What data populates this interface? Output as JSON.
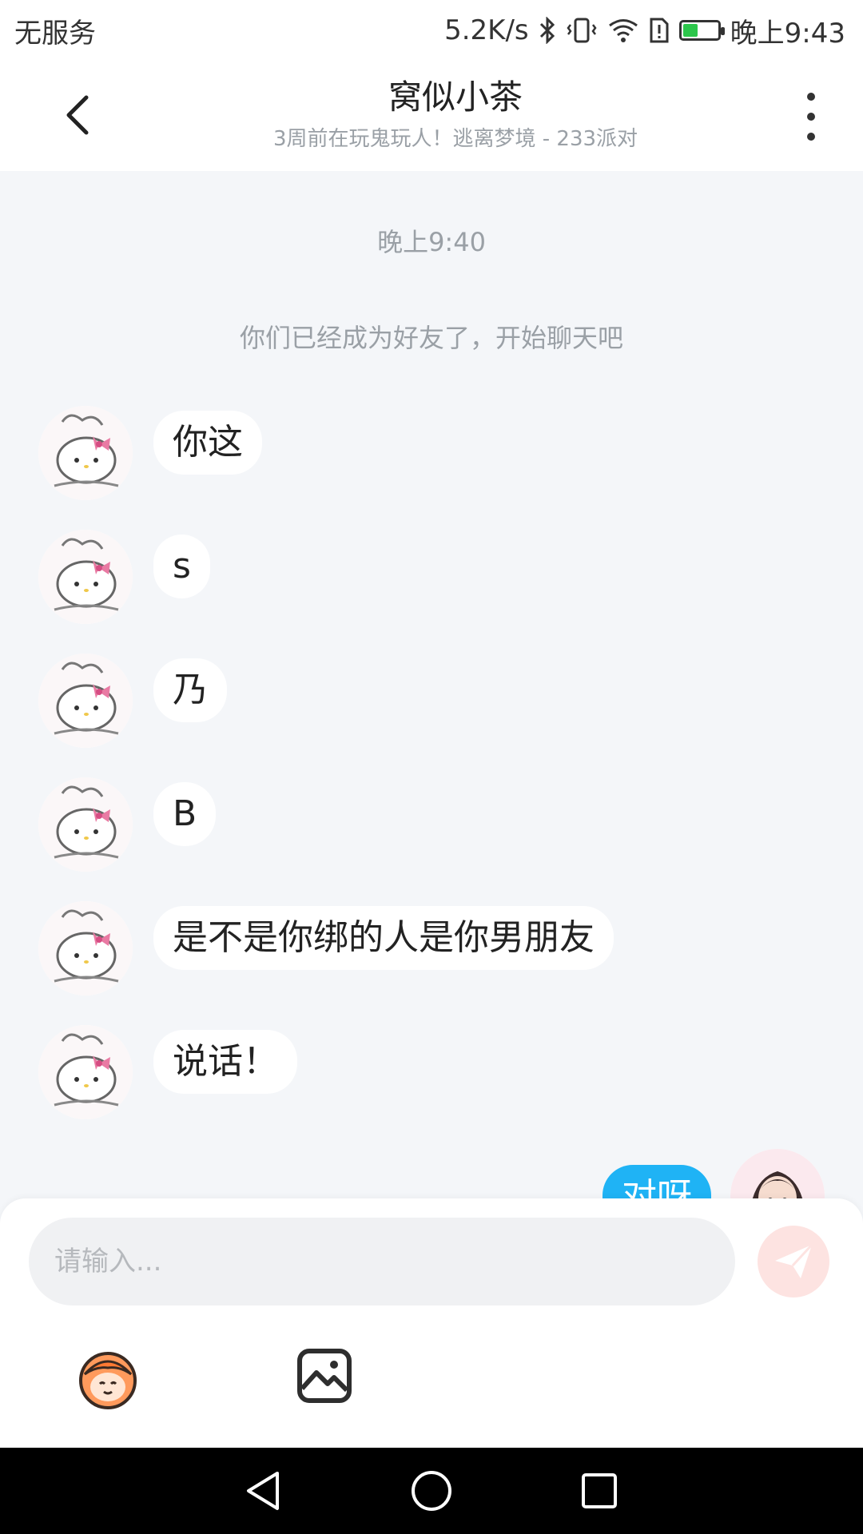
{
  "status_bar": {
    "carrier": "无服务",
    "speed": "5.2K/s",
    "time": "晚上9:43",
    "icons": [
      "bluetooth-icon",
      "vibrate-icon",
      "wifi-icon",
      "sim-alert-icon",
      "battery-icon"
    ],
    "battery_color": "#2cc64b"
  },
  "header": {
    "title": "窝似小茶",
    "subtitle": "3周前在玩鬼玩人！逃离梦境 - 233派对",
    "back_icon": "chevron-left-icon",
    "more_icon": "more-vertical-icon"
  },
  "chat": {
    "time_separator": "晚上9:40",
    "system_message": "你们已经成为好友了，开始聊天吧",
    "incoming_messages": [
      {
        "text": "你这"
      },
      {
        "text": "s"
      },
      {
        "text": "乃"
      },
      {
        "text": "B"
      },
      {
        "text": "是不是你绑的人是你男朋友"
      },
      {
        "text": "说话！"
      }
    ],
    "outgoing_messages": [
      {
        "text": "对呀"
      }
    ],
    "outgoing_bubble_color": "#1fb3f5"
  },
  "input": {
    "placeholder": "请输入...",
    "value": "",
    "send_icon": "send-icon",
    "emoji_icon": "emoji-character-icon",
    "image_icon": "image-icon"
  },
  "navbar": {
    "icons": [
      "nav-back-icon",
      "nav-home-icon",
      "nav-recents-icon"
    ]
  }
}
